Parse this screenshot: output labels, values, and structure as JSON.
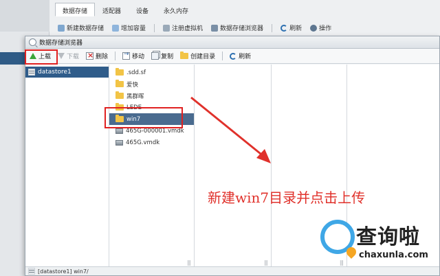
{
  "background": {
    "tabs": [
      "数据存储",
      "适配器",
      "设备",
      "永久内存"
    ],
    "toolbar": [
      "新建数据存储",
      "增加容量",
      "注册虚拟机",
      "数据存储浏览器",
      "刷新",
      "操作"
    ]
  },
  "dialog": {
    "title": "数据存储浏览器",
    "toolbar": {
      "upload": "上载",
      "download": "下载",
      "delete": "删除",
      "move": "移动",
      "copy": "复制",
      "new_folder": "创建目录",
      "refresh": "刷新"
    },
    "tree": {
      "datastore": "datastore1"
    },
    "files": [
      {
        "name": ".sdd.sf",
        "type": "folder"
      },
      {
        "name": "爱快",
        "type": "folder"
      },
      {
        "name": "黑群晖",
        "type": "folder"
      },
      {
        "name": "LEDE",
        "type": "folder"
      },
      {
        "name": "win7",
        "type": "folder",
        "selected": true
      },
      {
        "name": "465G-000001.vmdk",
        "type": "vmdk"
      },
      {
        "name": "465G.vmdk",
        "type": "vmdk"
      }
    ],
    "status_path": "[datastore1] win7/"
  },
  "annotation": {
    "caption": "新建win7目录并点击上传",
    "color": "#e0312b"
  },
  "watermark": {
    "name": "查询啦",
    "url": "chaxunla.com",
    "accent": "#3fa7e6"
  }
}
